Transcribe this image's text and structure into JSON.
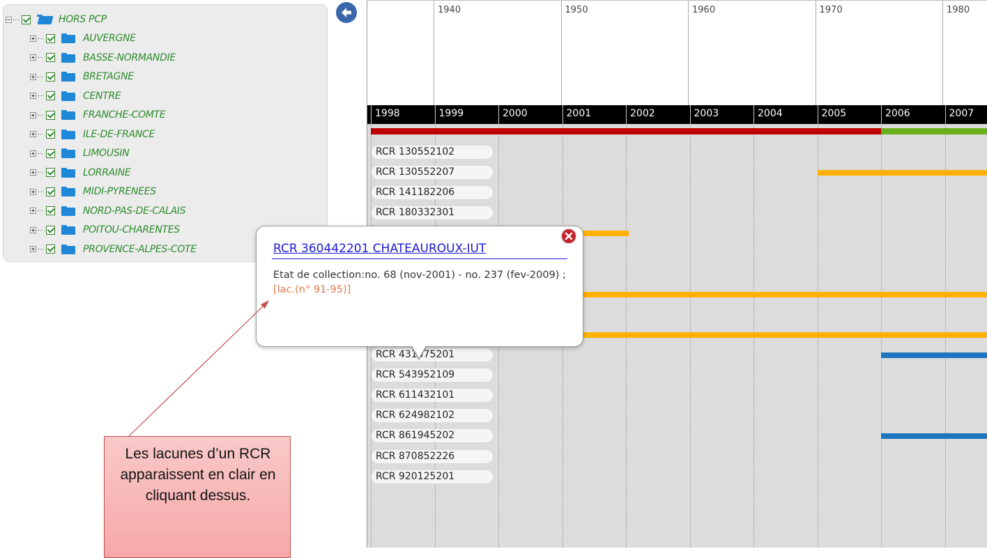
{
  "tree": {
    "root": {
      "label": "HORS PCP",
      "checked": true
    },
    "items": [
      {
        "label": "AUVERGNE"
      },
      {
        "label": "BASSE-NORMANDIE"
      },
      {
        "label": "BRETAGNE"
      },
      {
        "label": "CENTRE"
      },
      {
        "label": "FRANCHE-COMTE"
      },
      {
        "label": "ILE-DE-FRANCE"
      },
      {
        "label": "LIMOUSIN"
      },
      {
        "label": "LORRAINE"
      },
      {
        "label": "MIDI-PYRENEES"
      },
      {
        "label": "NORD-PAS-DE-CALAIS"
      },
      {
        "label": "POITOU-CHARENTES"
      },
      {
        "label": "PROVENCE-ALPES-COTE"
      }
    ]
  },
  "timeline": {
    "decades": [
      "1940",
      "1950",
      "1960",
      "1970",
      "1980"
    ],
    "years": [
      "1998",
      "1999",
      "2000",
      "2001",
      "2002",
      "2003",
      "2004",
      "2005",
      "2006",
      "2007"
    ],
    "strip_colors": {
      "before_2006": "#c00000",
      "from_2006": "#6aaf1c"
    },
    "bar_colors": {
      "orange": "#ffb000",
      "blue": "#1f76c0"
    },
    "rows": [
      {
        "rcr": "RCR 130552102"
      },
      {
        "rcr": "RCR 130552207",
        "bar": {
          "from": 2005,
          "color": "orange"
        }
      },
      {
        "rcr": "RCR 141182206"
      },
      {
        "rcr": "RCR 180332301"
      },
      {
        "rcr": "",
        "bar": {
          "from": 2001,
          "to": 2002,
          "color": "orange"
        }
      },
      {
        "rcr": ""
      },
      {
        "rcr": ""
      },
      {
        "rcr": "",
        "bar": {
          "from": 2001,
          "color": "orange"
        }
      },
      {
        "rcr": ""
      },
      {
        "rcr": "RCR 360442201",
        "bar": {
          "from": 2001,
          "color": "orange"
        }
      },
      {
        "rcr": "RCR 431575201",
        "bar": {
          "from": 2006,
          "color": "blue"
        }
      },
      {
        "rcr": "RCR 543952109"
      },
      {
        "rcr": "RCR 611432101"
      },
      {
        "rcr": "RCR 624982102"
      },
      {
        "rcr": "RCR 861945202",
        "bar": {
          "from": 2006,
          "color": "blue"
        }
      },
      {
        "rcr": "RCR 870852226"
      },
      {
        "rcr": "RCR 920125201"
      }
    ]
  },
  "popup": {
    "title": "RCR 360442201 CHATEAUROUX-IUT",
    "text": "Etat de collection:no. 68 (nov-2001) - no. 237 (fev-2009) ;",
    "lacunes": "[lac.(n° 91-95)]"
  },
  "callout": {
    "text": "Les lacunes d’un RCR apparaissent en clair en cliquant dessus."
  },
  "icons": {
    "back": "arrow-left-icon",
    "close": "close-icon",
    "folder": "folder-icon",
    "checkbox": "checkbox-checked-icon",
    "expander": "tree-expander-icon"
  }
}
